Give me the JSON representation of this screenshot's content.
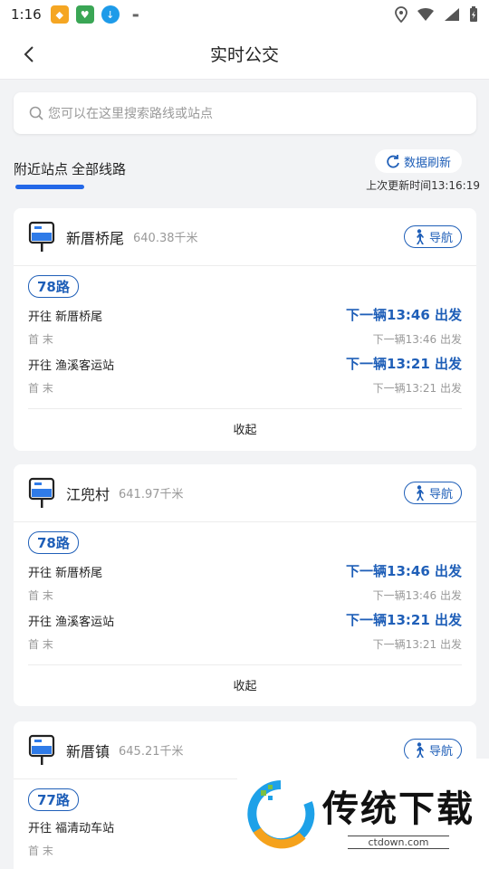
{
  "status_bar": {
    "time": "1:16"
  },
  "header": {
    "title": "实时公交"
  },
  "search": {
    "placeholder": "您可以在这里搜索路线或站点"
  },
  "tabs": [
    {
      "label": "附近站点",
      "active": true
    },
    {
      "label": "全部线路",
      "active": false
    }
  ],
  "refresh": {
    "label": "数据刷新",
    "update_time": "上次更新时间13:16:19"
  },
  "stops": [
    {
      "name": "新厝桥尾",
      "distance": "640.38千米",
      "nav_label": "导航",
      "route": "78路",
      "directions": [
        {
          "dest": "开往 新厝桥尾",
          "next": "下一辆13:46 出发",
          "ends": "首 末",
          "sub_next": "下一辆13:46 出发"
        },
        {
          "dest": "开往 渔溪客运站",
          "next": "下一辆13:21 出发",
          "ends": "首 末",
          "sub_next": "下一辆13:21 出发"
        }
      ],
      "collapse": "收起"
    },
    {
      "name": "江兜村",
      "distance": "641.97千米",
      "nav_label": "导航",
      "route": "78路",
      "directions": [
        {
          "dest": "开往 新厝桥尾",
          "next": "下一辆13:46 出发",
          "ends": "首 末",
          "sub_next": "下一辆13:46 出发"
        },
        {
          "dest": "开往 渔溪客运站",
          "next": "下一辆13:21 出发",
          "ends": "首 末",
          "sub_next": "下一辆13:21 出发"
        }
      ],
      "collapse": "收起"
    },
    {
      "name": "新厝镇",
      "distance": "645.21千米",
      "nav_label": "导航",
      "route": "77路",
      "directions": [
        {
          "dest": "开往 福清动车站",
          "ends": "首 末"
        }
      ]
    }
  ],
  "watermark": {
    "title": "传统下载",
    "url": "ctdown.com"
  },
  "colors": {
    "accent": "#1f5fb8",
    "tab_underline": "#2468e8",
    "background": "#f2f3f5"
  }
}
